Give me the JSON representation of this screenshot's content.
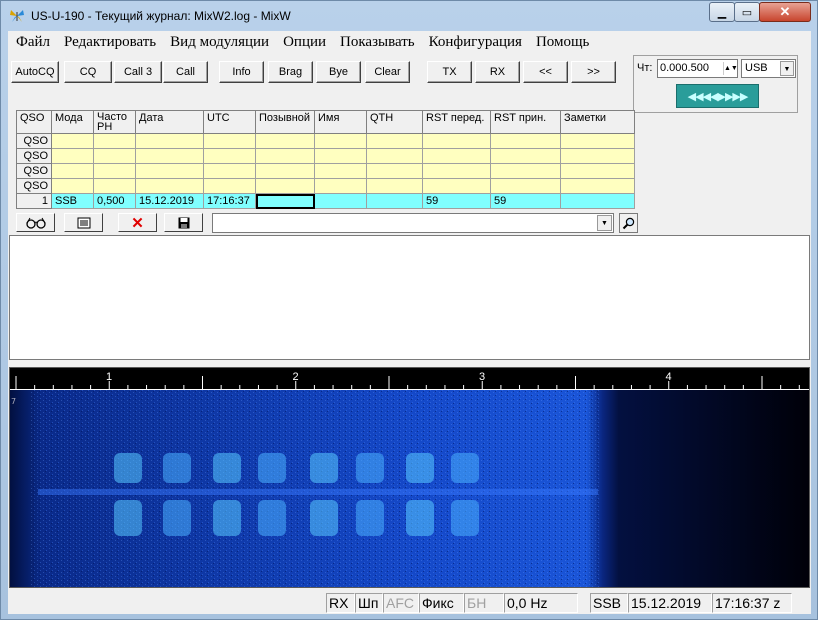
{
  "window": {
    "title": "US-U-190 - Текущий журнал: MixW2.log - MixW",
    "min_label": "▁",
    "max_label": "▭",
    "close_label": "✕"
  },
  "menu": [
    "Файл",
    "Редактировать",
    "Вид модуляции",
    "Опции",
    "Показывать",
    "Конфигурация",
    "Помощь"
  ],
  "toolbar": {
    "buttons": [
      "AutoCQ",
      "CQ",
      "Call 3",
      "Call",
      "Info",
      "Brag",
      "Bye",
      "Clear",
      "TX",
      "RX",
      "<<",
      ">>"
    ]
  },
  "right_panel": {
    "freq_label": "Чт:",
    "freq_value": "0.000.500",
    "mode_value": "USB",
    "tune_arrows": "◀◀◀◀▶▶▶▶"
  },
  "log": {
    "columns": [
      "QSO",
      "Мода",
      "Часто\nРН",
      "Дата",
      "UTC",
      "Позывной",
      "Имя",
      "QTH",
      "RST перед.",
      "RST прин.",
      "Заметки"
    ],
    "empty_rows": [
      "QSO",
      "QSO",
      "QSO",
      "QSO"
    ],
    "current_row": [
      "1",
      "SSB",
      "0,500",
      "15.12.2019",
      "17:16:37",
      "",
      "",
      "",
      "59",
      "59",
      ""
    ]
  },
  "filter": {
    "search_value": ""
  },
  "waterfall": {
    "scale_labels": [
      "1",
      "2",
      "3",
      "4"
    ]
  },
  "status": {
    "rx": "RX",
    "squelch": "Шп",
    "afc": "AFC",
    "fix": "Фикс",
    "bn": "БН",
    "offset": "0,0 Hz",
    "mode": "SSB",
    "date": "15.12.2019",
    "time": "17:16:37 z"
  },
  "colors": {
    "log_empty_bg": "#ffffc0",
    "log_current_bg": "#80ffff",
    "waterfall_bg": "#000000",
    "waterfall_signal": "#2060ff",
    "tune_bg": "#2a9d9a"
  },
  "icons": {
    "app": "butterfly-icon",
    "glasses": "glasses-icon",
    "edit": "edit-record-icon",
    "delete": "delete-icon",
    "save": "save-icon",
    "search": "magnifier-icon"
  }
}
